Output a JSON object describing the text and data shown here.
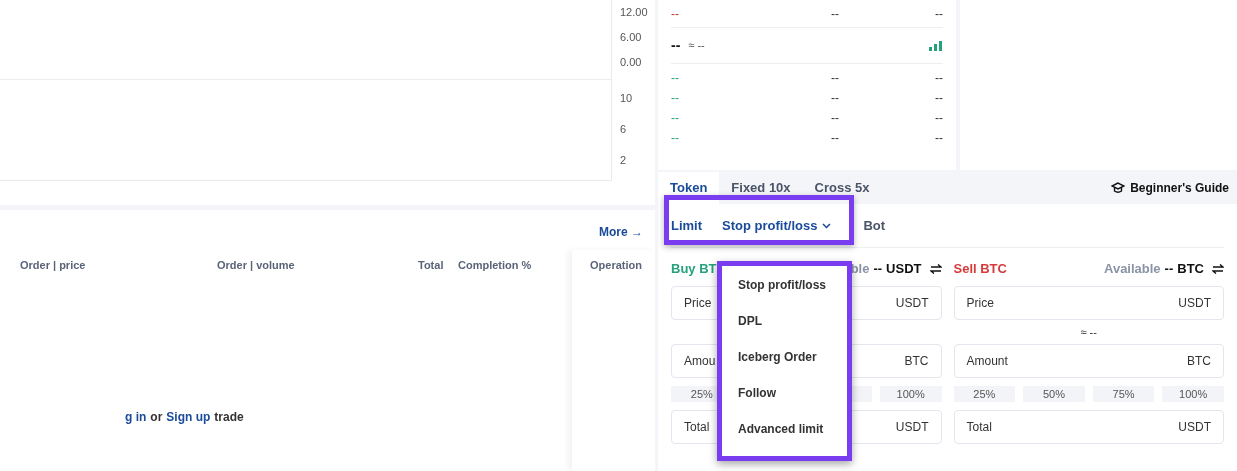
{
  "chart": {
    "price_axis": [
      "12.00",
      "6.00",
      "0.00"
    ],
    "volume_axis": [
      "10",
      "6",
      "2"
    ]
  },
  "orders": {
    "more_link": "More →",
    "columns": [
      "Order | price",
      "Order | volume",
      "Total",
      "Completion %"
    ],
    "operation_column": "Operation",
    "login_prompt": [
      {
        "kind": "link",
        "text": "g in"
      },
      {
        "kind": "text",
        "text": "or"
      },
      {
        "kind": "link",
        "text": "Sign up"
      },
      {
        "kind": "text",
        "text": "trade"
      }
    ]
  },
  "order_book": {
    "asks": [
      {
        "price": "--",
        "amount": "--",
        "total": "--"
      }
    ],
    "last_price": "--",
    "last_price_approx": "≈ --",
    "bids": [
      {
        "price": "--",
        "amount": "--",
        "total": "--"
      },
      {
        "price": "--",
        "amount": "--",
        "total": "--"
      },
      {
        "price": "--",
        "amount": "--",
        "total": "--"
      },
      {
        "price": "--",
        "amount": "--",
        "total": "--"
      }
    ]
  },
  "trade": {
    "tabs": [
      {
        "label": "Token",
        "selected": true
      },
      {
        "label": "Fixed 10x",
        "selected": false
      },
      {
        "label": "Cross 5x",
        "selected": false
      }
    ],
    "guide": "Beginner's Guide",
    "order_types": [
      {
        "label": "Limit",
        "kind": "plain",
        "selected": true
      },
      {
        "label": "Stop profit/loss",
        "kind": "dropdown",
        "selected": true
      },
      {
        "label": "Bot",
        "kind": "plain",
        "selected": false
      }
    ],
    "dropdown": {
      "open": true,
      "items": [
        "Stop profit/loss",
        "DPL",
        "Iceberg Order",
        "Follow",
        "Advanced limit"
      ]
    },
    "buy": {
      "title": "Buy BT",
      "available_label": "ble",
      "available_value": "--",
      "available_unit": "USDT",
      "fields": [
        {
          "label": "Price",
          "unit": "USDT"
        },
        {
          "label": "Amou",
          "unit": "BTC"
        },
        {
          "label": "Total",
          "unit": "USDT"
        }
      ],
      "percents": [
        "25%",
        "100%"
      ]
    },
    "sell": {
      "title": "Sell BTC",
      "available_label": "Available",
      "available_value": "--",
      "available_unit": "BTC",
      "fields": [
        {
          "label": "Price",
          "unit": "USDT"
        },
        {
          "label": "Amount",
          "unit": "BTC"
        },
        {
          "label": "Total",
          "unit": "USDT"
        }
      ],
      "approx": "≈ --",
      "percents": [
        "25%",
        "50%",
        "75%",
        "100%"
      ]
    }
  }
}
